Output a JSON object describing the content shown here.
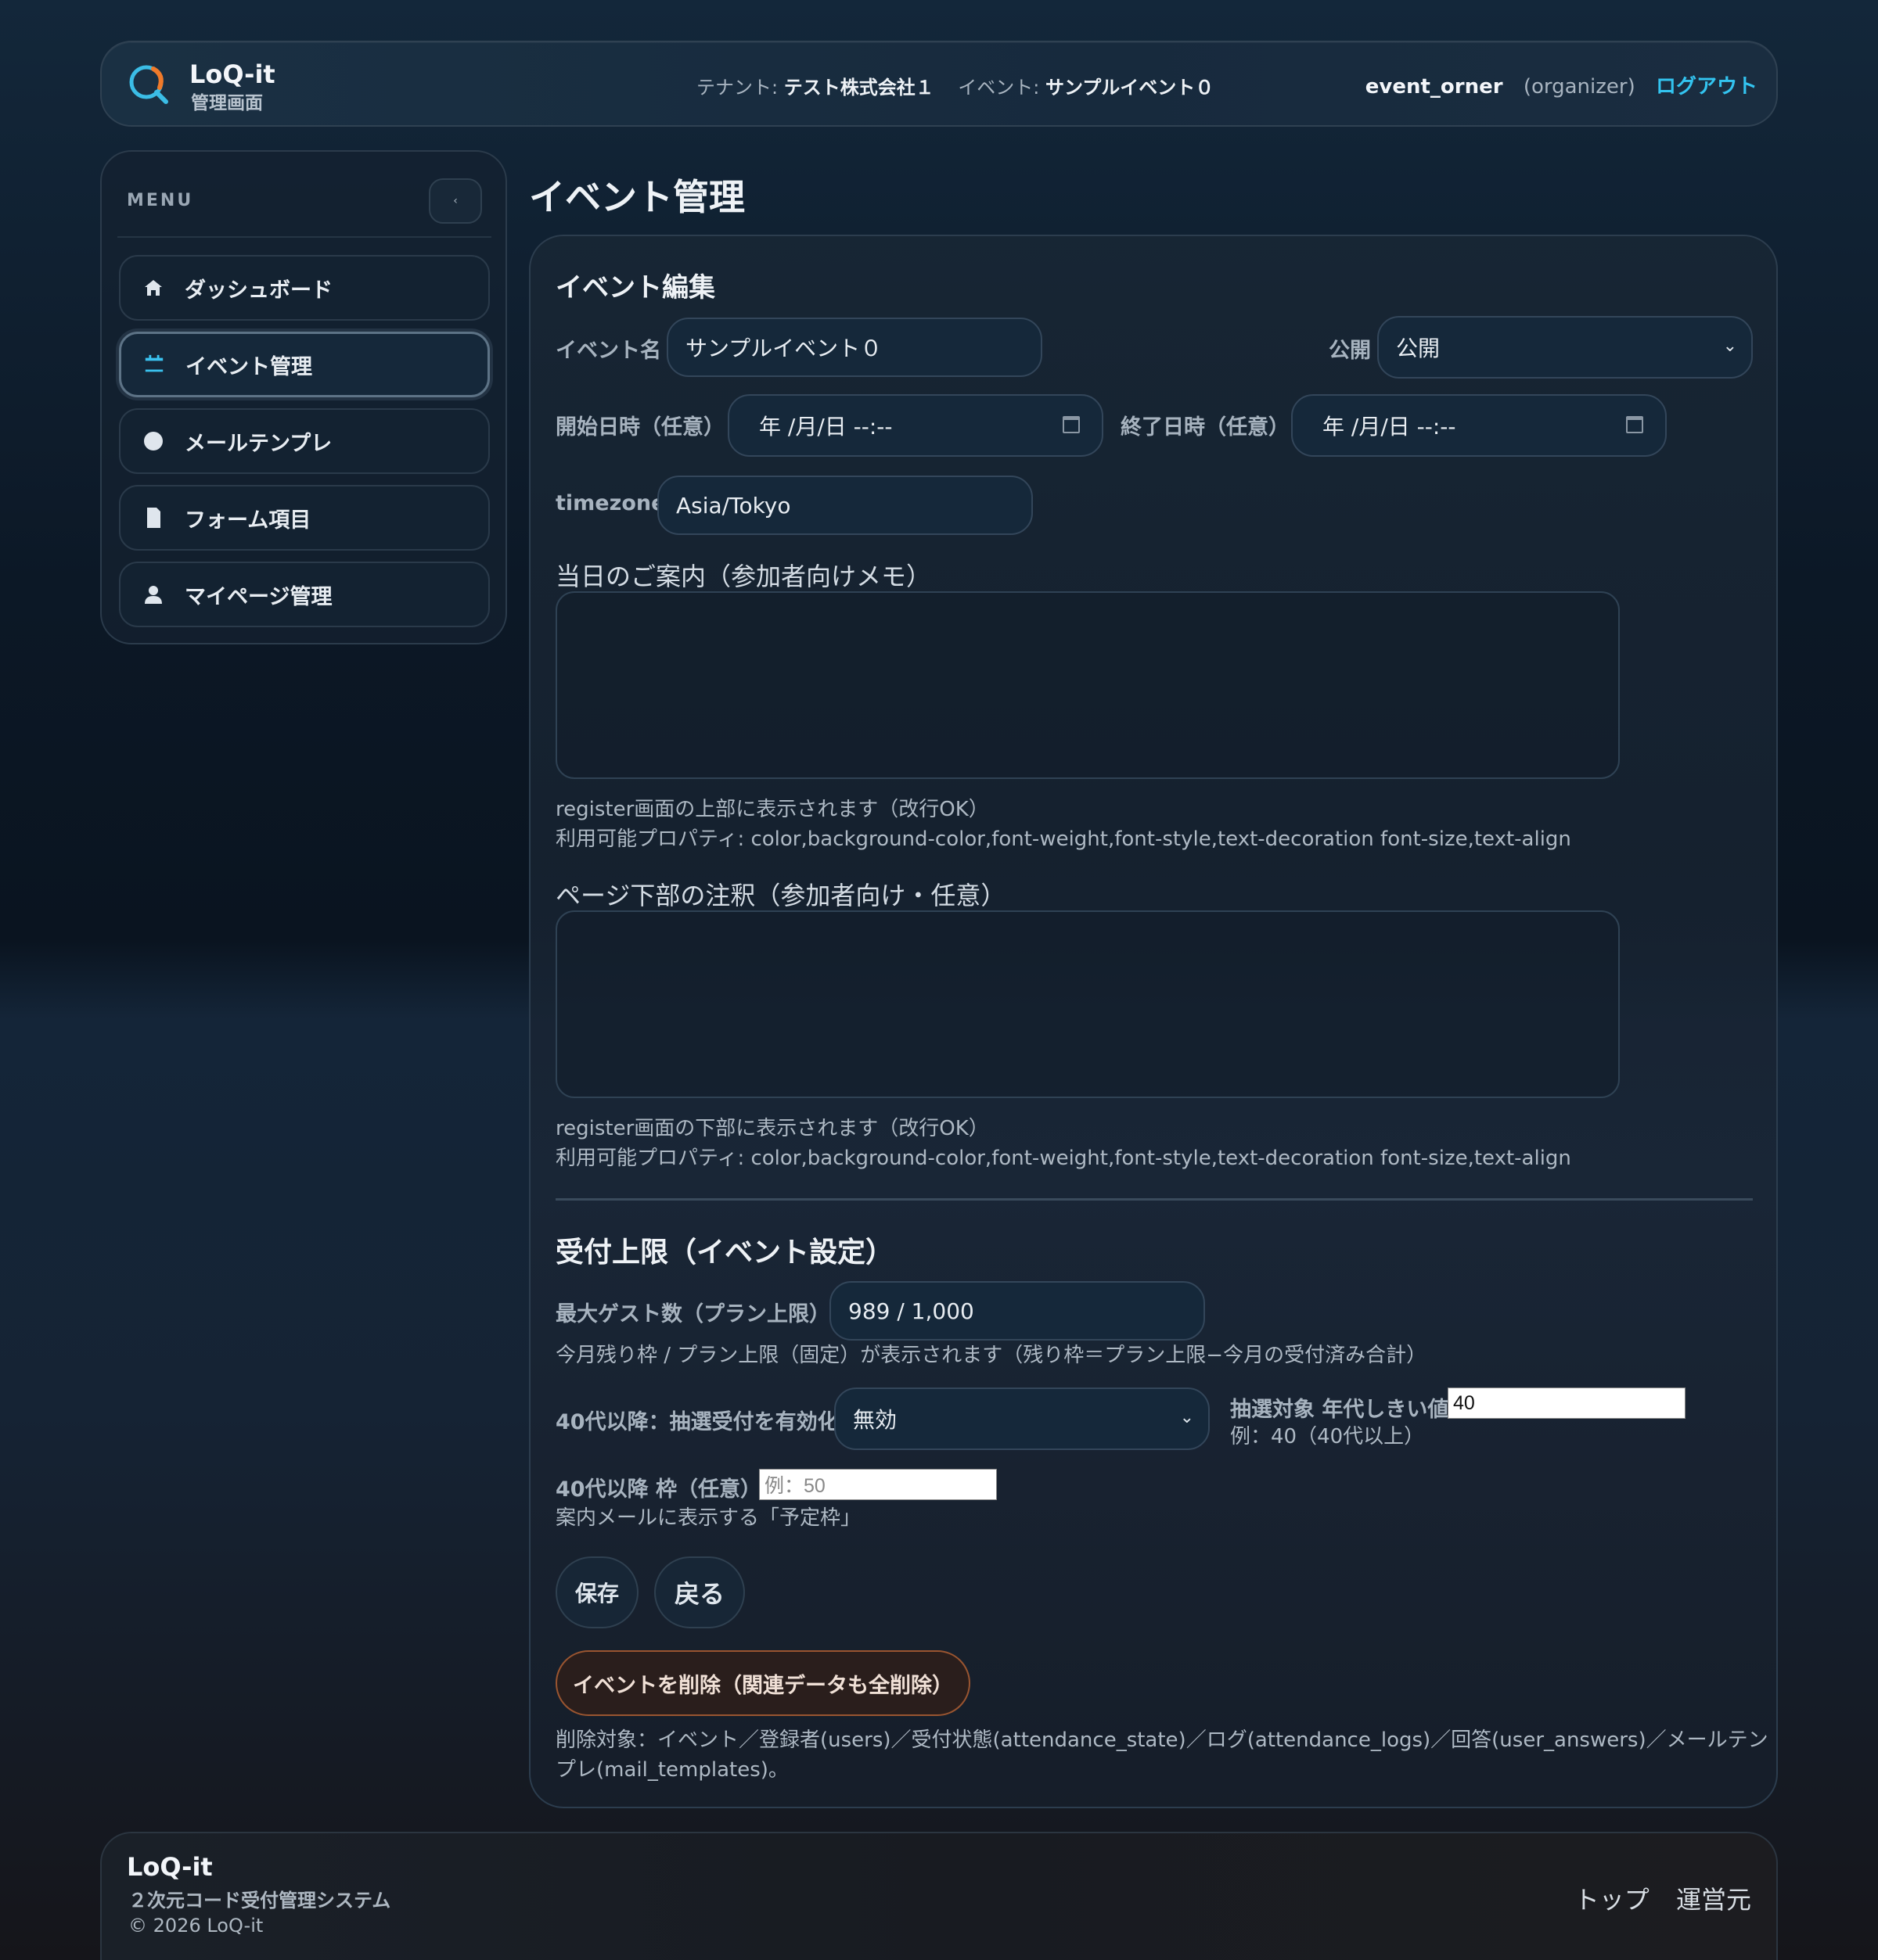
{
  "header": {
    "app_name": "LoQ-it",
    "app_sub": "管理画面",
    "tenant_label": "テナント:",
    "tenant_value": "テスト株式会社１",
    "event_label": "イベント:",
    "event_value": "サンプルイベント０",
    "user_name": "event_orner",
    "user_role": "(organizer)",
    "logout": "ログアウト"
  },
  "sidebar": {
    "menu_label": "MENU",
    "collapse_glyph": "‹",
    "items": [
      {
        "label": "ダッシュボード",
        "icon": "home-icon"
      },
      {
        "label": "イベント管理",
        "icon": "calendar-icon"
      },
      {
        "label": "メールテンプレ",
        "icon": "circle-icon"
      },
      {
        "label": "フォーム項目",
        "icon": "document-icon"
      },
      {
        "label": "マイページ管理",
        "icon": "user-icon"
      }
    ]
  },
  "page": {
    "title": "イベント管理"
  },
  "edit": {
    "title": "イベント編集",
    "event_name_label": "イベント名",
    "event_name_value": "サンプルイベント０",
    "publish_label": "公開",
    "publish_value": "公開",
    "start_label": "開始日時（任意）",
    "start_value": "年 /月/日 --:--",
    "end_label": "終了日時（任意）",
    "end_value": "年 /月/日 --:--",
    "timezone_label": "timezone",
    "timezone_value": "Asia/Tokyo",
    "guide_label": "当日のご案内（参加者向けメモ）",
    "guide_value": "",
    "guide_help1": "register画面の上部に表示されます（改行OK）",
    "guide_help2": "利用可能プロパティ: color,background-color,font-weight,font-style,text-decoration font-size,text-align",
    "footer_note_label": "ページ下部の注釈（参加者向け・任意）",
    "footer_note_value": "",
    "footer_note_help1": "register画面の下部に表示されます（改行OK）",
    "footer_note_help2": "利用可能プロパティ: color,background-color,font-weight,font-style,text-decoration font-size,text-align"
  },
  "limits": {
    "title": "受付上限（イベント設定）",
    "max_guests_label": "最大ゲスト数（プラン上限）",
    "max_guests_value": "989 / 1,000",
    "max_guests_help": "今月残り枠 / プラン上限（固定）が表示されます（残り枠＝プラン上限−今月の受付済み合計）",
    "lottery_label": "40代以降：抽選受付を有効化",
    "lottery_value": "無効",
    "threshold_label": "抽選対象 年代しきい値",
    "threshold_value": "40",
    "threshold_help": "例：40（40代以上）",
    "quota_label": "40代以降 枠（任意）",
    "quota_placeholder": "例：50",
    "quota_help": "案内メールに表示する「予定枠」"
  },
  "actions": {
    "save": "保存",
    "back": "戻る",
    "delete": "イベントを削除（関連データも全削除）",
    "delete_help1": "削除対象：イベント／登録者(users)／受付状態(attendance_state)／ログ(attendance_logs)／回答(user_answers)／メールテン",
    "delete_help2": "プレ(mail_templates)。"
  },
  "footer": {
    "title": "LoQ-it",
    "subtitle": "２次元コード受付管理システム",
    "copyright": "© 2026 LoQ-it",
    "links": [
      "トップ",
      "運営元"
    ]
  },
  "colors": {
    "accent": "#33c4f0",
    "danger_border": "#9a5530",
    "logo_orange": "#f07a2a"
  }
}
